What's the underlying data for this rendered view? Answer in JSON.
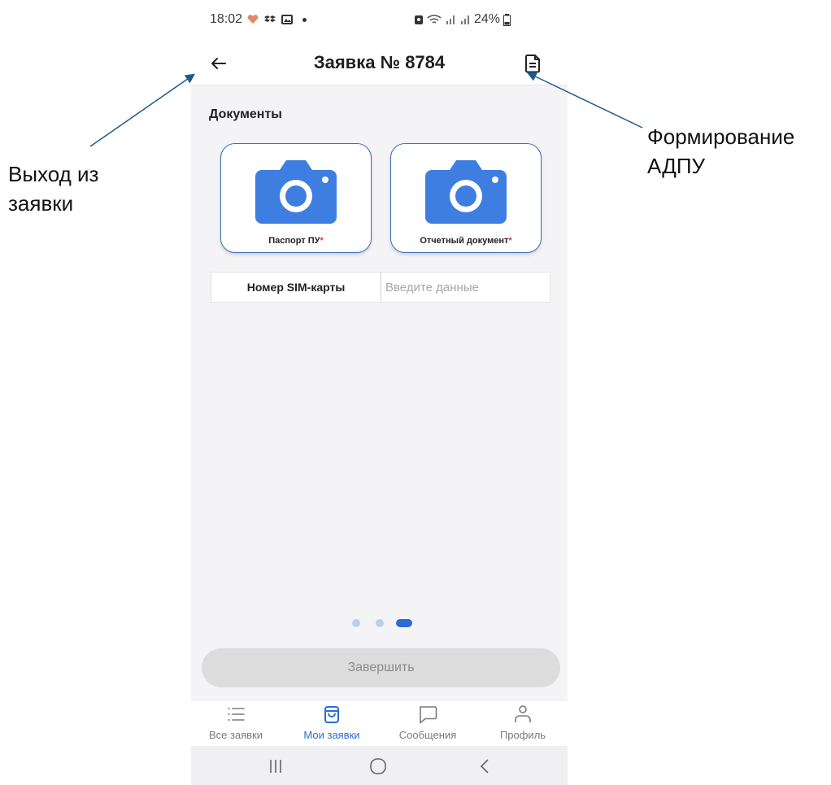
{
  "status_bar": {
    "time": "18:02",
    "battery": "24%"
  },
  "header": {
    "title": "Заявка № 8784"
  },
  "section": {
    "title": "Документы"
  },
  "documents": [
    {
      "label": "Паспорт ПУ",
      "required_mark": "*"
    },
    {
      "label": "Отчетный документ",
      "required_mark": "*"
    }
  ],
  "sim_field": {
    "label": "Номер SIM-карты",
    "value": "",
    "placeholder": "Введите данные"
  },
  "pager": {
    "total": 3,
    "active_index": 2
  },
  "finish_button": {
    "label": "Завершить"
  },
  "nav": {
    "items": [
      {
        "label": "Все заявки",
        "icon": "list-icon"
      },
      {
        "label": "Мои заявки",
        "icon": "shopping-bag-icon"
      },
      {
        "label": "Сообщения",
        "icon": "chat-bubble-icon"
      },
      {
        "label": "Профиль",
        "icon": "person-icon"
      }
    ],
    "active_index": 1
  },
  "annotations": {
    "exit": "Выход из\nзаявки",
    "adpu_line1": "Формирование",
    "adpu_line2": "АДПУ"
  },
  "colors": {
    "accent": "#2c6bd6",
    "camera": "#3d7ee0",
    "required": "#d9373f",
    "arrow": "#1f5b8a"
  }
}
